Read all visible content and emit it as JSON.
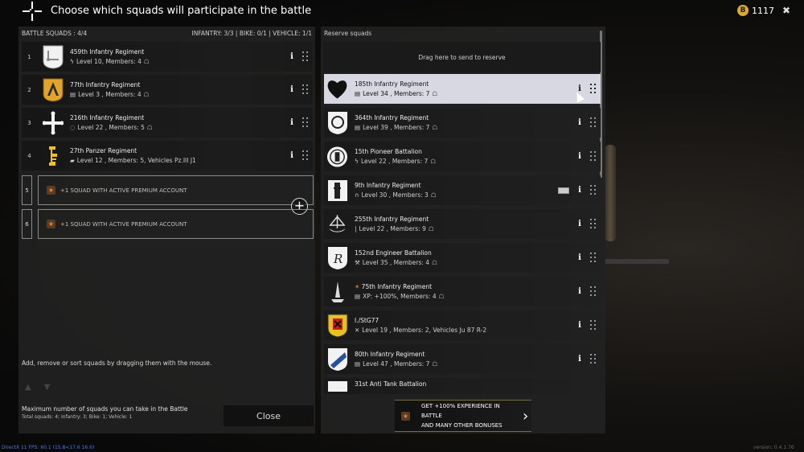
{
  "header": {
    "title": "Choose which squads will participate in the battle",
    "coins": "1117",
    "coin_icon_letter": "B"
  },
  "battle": {
    "label": "BATTLE SQUADS : 4/4",
    "counts": "INFANTRY: 3/3 | BIKE: 0/1 | VEHICLE: 1/1",
    "squads": [
      {
        "num": "1",
        "name": "459th Infantry Regiment",
        "info": "Level 10, Members: 4",
        "icon": "bolt-icon"
      },
      {
        "num": "2",
        "name": "77th Infantry Regiment",
        "info": "Level 3 , Members: 4",
        "icon": "book-icon"
      },
      {
        "num": "3",
        "name": "216th Infantry Regiment",
        "info": "Level 22 , Members: 5",
        "icon": "target-icon"
      },
      {
        "num": "4",
        "name": "27th Panzer Regiment",
        "info": "Level 12 , Members: 5, Vehicles Pz.III J1",
        "icon": "tank-icon"
      }
    ],
    "premium_slots": [
      {
        "num": "5",
        "text": "+1 SQUAD WITH ACTIVE PREMIUM ACCOUNT"
      },
      {
        "num": "6",
        "text": "+1 SQUAD WITH ACTIVE PREMIUM ACCOUNT"
      }
    ],
    "hint": "Add, remove or sort squads by dragging them with the mouse.",
    "max_text": "Maximum number of squads you can take in the Battle",
    "totals": "Total squads: 4; Infantry: 3; Bike: 1; Vehicle: 1",
    "close_label": "Close"
  },
  "reserve": {
    "label": "Reserve squads",
    "drop_text": "Drag here to send to reserve",
    "squads": [
      {
        "name": "185th Infantry Regiment",
        "info": "Level 34 , Members: 7",
        "selected": true
      },
      {
        "name": "364th Infantry Regiment",
        "info": "Level 39 , Members: 7"
      },
      {
        "name": "15th Pioneer Battalion",
        "info": "Level 22 , Members: 7"
      },
      {
        "name": "9th Infantry Regiment",
        "info": "Level 30 , Members: 3"
      },
      {
        "name": "255th Infantry Regiment",
        "info": "Level 22 , Members: 9"
      },
      {
        "name": "152nd Engineer Battalion",
        "info": "Level 35 , Members: 4"
      },
      {
        "name": "75th Infantry Regiment",
        "info": "XP: +100%, Members: 4"
      },
      {
        "name": "I./StG77",
        "info": "Level 19 , Members: 2, Vehicles Ju 87 R-2"
      },
      {
        "name": "80th Infantry Regiment",
        "info": "Level 47 , Members: 7"
      },
      {
        "name": "31st Anti Tank Battalion",
        "info": ""
      }
    ],
    "premium_line1": "GET +100% EXPERIENCE IN BATTLE",
    "premium_line2": "AND MANY OTHER BONUSES"
  },
  "footer": {
    "stats": "DirectX 11 FPS: 60.1 (15.8<17.6 16.6)",
    "version": "version: 0.4.1.76"
  },
  "colors": {
    "accent_gold": "#d9a936",
    "premium_orange": "#e0893a",
    "selected_row": "#d8d8e3"
  }
}
